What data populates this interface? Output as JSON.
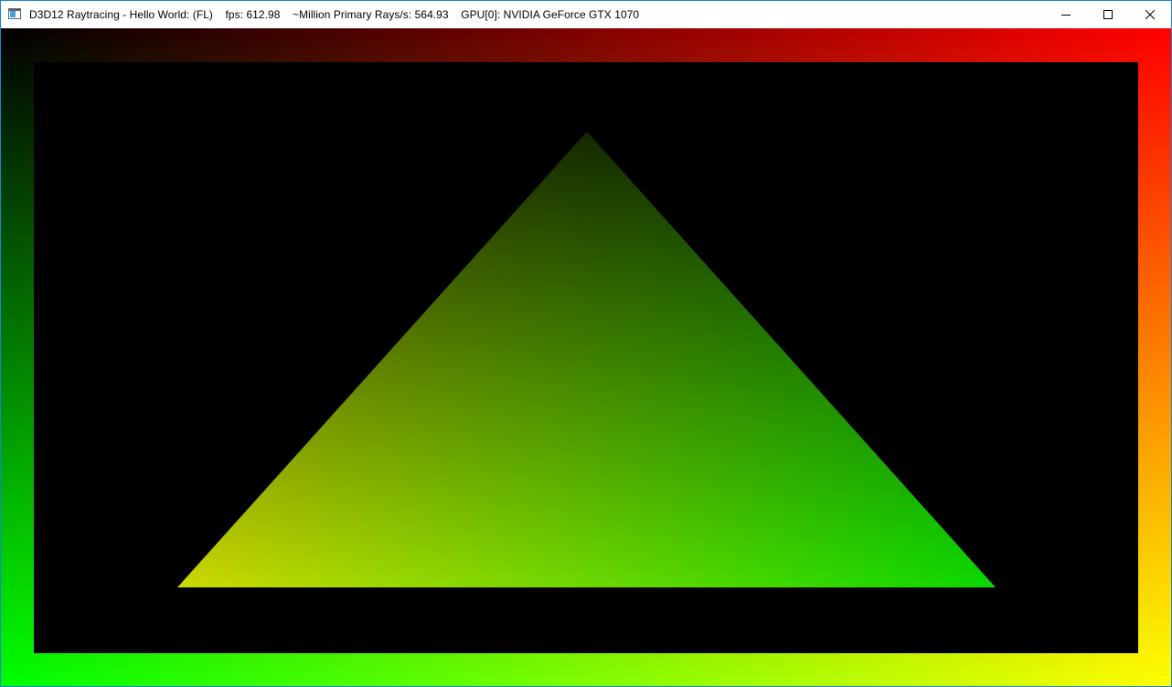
{
  "window": {
    "title_segments": [
      "D3D12 Raytracing - Hello World: (FL)",
      "fps: 612.98",
      "~Million Primary Rays/s: 564.93",
      "GPU[0]: NVIDIA GeForce GTX 1070"
    ],
    "accent_border_color": "#1883d7",
    "icons": {
      "app": "app-window-icon",
      "minimize": "minimize-icon",
      "maximize": "maximize-icon",
      "close": "close-icon"
    }
  },
  "scene": {
    "background_color": "#000000",
    "border_gradient_corners": {
      "top_left": "#000000",
      "top_right": "#ff0000",
      "bottom_left": "#00ff00",
      "bottom_right": "#ffff00"
    },
    "triangle_vertex_colors": {
      "top": "#000000",
      "bottom_left": "#ffff00",
      "bottom_right": "#00ff00"
    }
  }
}
